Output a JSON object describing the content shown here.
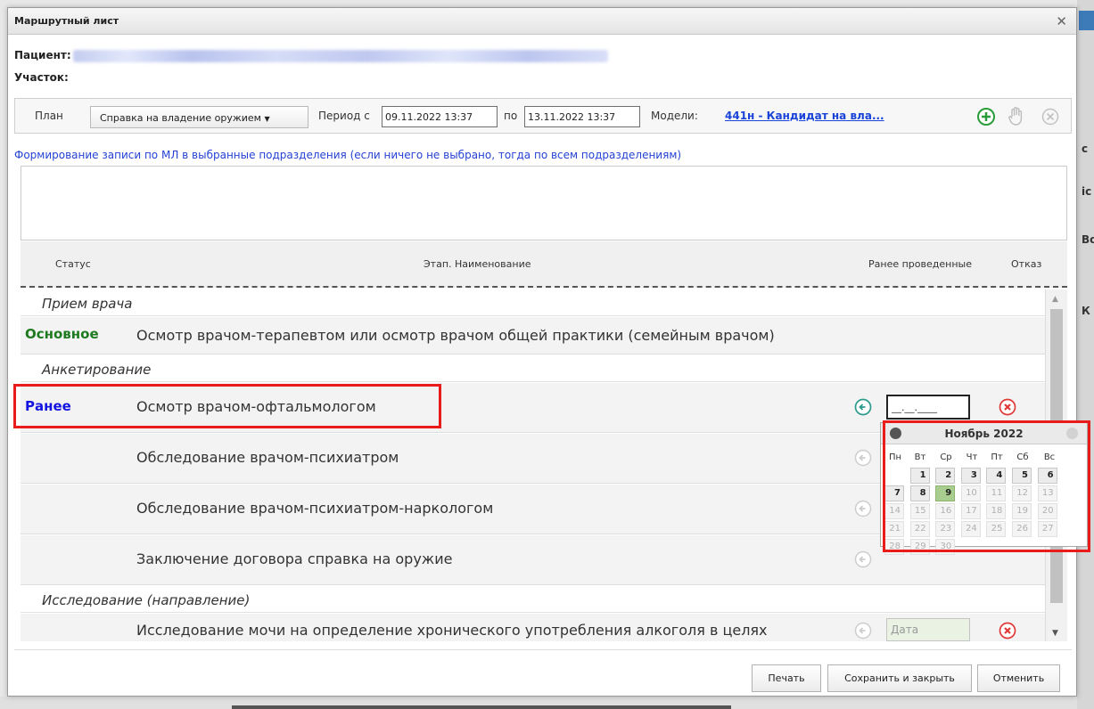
{
  "window": {
    "title": "Маршрутный лист"
  },
  "patient": {
    "label": "Пациент:",
    "section_label": "Участок:"
  },
  "plan": {
    "plan_label": "План",
    "plan_value": "Справка на владение оружием",
    "period_label": "Период с",
    "date_from": "09.11.2022 13:37",
    "to_label": "по",
    "date_to": "13.11.2022 13:37",
    "models_label": "Модели:",
    "models_link": "441н - Кандидат на вла..."
  },
  "form_text": "Формирование записи по МЛ в выбранные подразделения (если ничего не выбрано, тогда по всем подразделениям)",
  "table": {
    "headers": {
      "status": "Статус",
      "name": "Этап. Наименование",
      "prior": "Ранее проведенные",
      "refuse": "Отказ"
    },
    "groups": {
      "g1": "Прием врача",
      "g2": "Анкетирование",
      "g3": "Исследование (направление)"
    },
    "rows": {
      "r1": {
        "status": "Основное",
        "name": "Осмотр врачом-терапевтом или осмотр врачом общей практики (семейным врачом)"
      },
      "r2": {
        "status": "Ранее",
        "name": "Осмотр врачом-офтальмологом",
        "date_value": "__.__.____"
      },
      "r3": {
        "name": "Обследование врачом-психиатром"
      },
      "r4": {
        "name": "Обследование врачом-психиатром-наркологом"
      },
      "r5": {
        "name": "Заключение договора справка на оружие"
      },
      "r6": {
        "name": "Исследование мочи на определение хронического употребления алкоголя в целях",
        "date_placeholder": "Дата"
      }
    }
  },
  "calendar": {
    "month": "Ноябрь 2022",
    "weekdays": [
      "Пн",
      "Вт",
      "Ср",
      "Чт",
      "Пт",
      "Сб",
      "Вс"
    ],
    "days": [
      "1",
      "2",
      "3",
      "4",
      "5",
      "6",
      "7",
      "8",
      "9",
      "10",
      "11",
      "12",
      "13",
      "14",
      "15",
      "16",
      "17",
      "18",
      "19",
      "20",
      "21",
      "22",
      "23",
      "24",
      "25",
      "26",
      "27",
      "28",
      "29",
      "30"
    ]
  },
  "footer": {
    "print": "Печать",
    "save_close": "Сохранить и закрыть",
    "cancel": "Отменить"
  },
  "colors": {
    "main_status": "#1e7a1e",
    "prior_status": "#1414e0",
    "highlight": "#ea1b1b",
    "link": "#1a44d8",
    "today": "#a9cd8f"
  }
}
